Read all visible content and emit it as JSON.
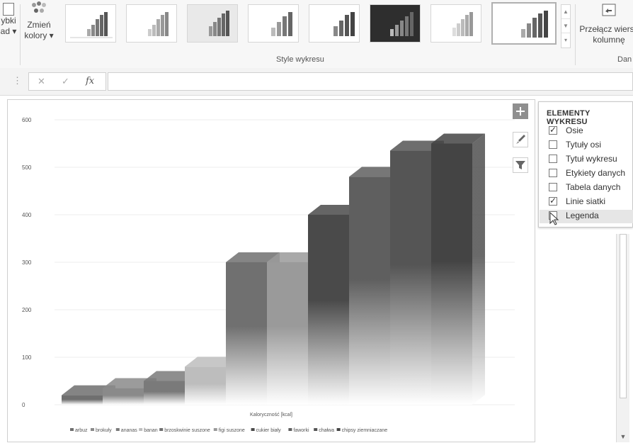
{
  "ribbon": {
    "left_button_line1": "ybki",
    "left_button_line2": "ad",
    "change_colors_line1": "Zmień",
    "change_colors_line2": "kolory",
    "styles_group_label": "Style wykresu",
    "switch_row_col_line1": "Przełącz wiersz",
    "switch_row_col_line2": "kolumnę",
    "data_group_label": "Dan"
  },
  "formula_bar": {
    "cancel_symbol": "✕",
    "confirm_symbol": "✓",
    "fx_symbol": "fx",
    "name_box_separator": "⋮",
    "value": ""
  },
  "chart_data": {
    "type": "bar",
    "style": "3d-column",
    "categories": [
      "arbuz",
      "brokuły",
      "ananas",
      "banan",
      "brzoskwinie suszone",
      "figi suszone",
      "cukier biały",
      "faworki",
      "chałwa",
      "chipsy ziemniaczane"
    ],
    "series": [
      {
        "values": [
          20,
          35,
          50,
          80,
          300,
          300,
          400,
          480,
          535,
          550
        ]
      }
    ],
    "xlabel": "Kaloryczność [kcal]",
    "ylabel": "",
    "ylim": [
      0,
      600
    ],
    "yticks": [
      "0",
      "100",
      "200",
      "300",
      "400",
      "500",
      "600"
    ],
    "grid": true,
    "legend_position": "bottom",
    "colors": [
      "#6f6f6f",
      "#8a8a8a",
      "#7a7a7a",
      "#bdbdbd",
      "#707070",
      "#9a9a9a",
      "#4a4a4a",
      "#5f5f5f",
      "#555555",
      "#444444"
    ]
  },
  "chart_elements_panel": {
    "title": "ELEMENTY WYKRESU",
    "options": [
      {
        "label": "Osie",
        "checked": true
      },
      {
        "label": "Tytuły osi",
        "checked": false
      },
      {
        "label": "Tytuł wykresu",
        "checked": false
      },
      {
        "label": "Etykiety danych",
        "checked": false
      },
      {
        "label": "Tabela danych",
        "checked": false
      },
      {
        "label": "Linie siatki",
        "checked": true
      },
      {
        "label": "Legenda",
        "checked": false
      }
    ]
  },
  "chart_side_buttons": {
    "elements_icon": "plus-icon",
    "styles_icon": "brush-icon",
    "filter_icon": "filter-icon"
  }
}
